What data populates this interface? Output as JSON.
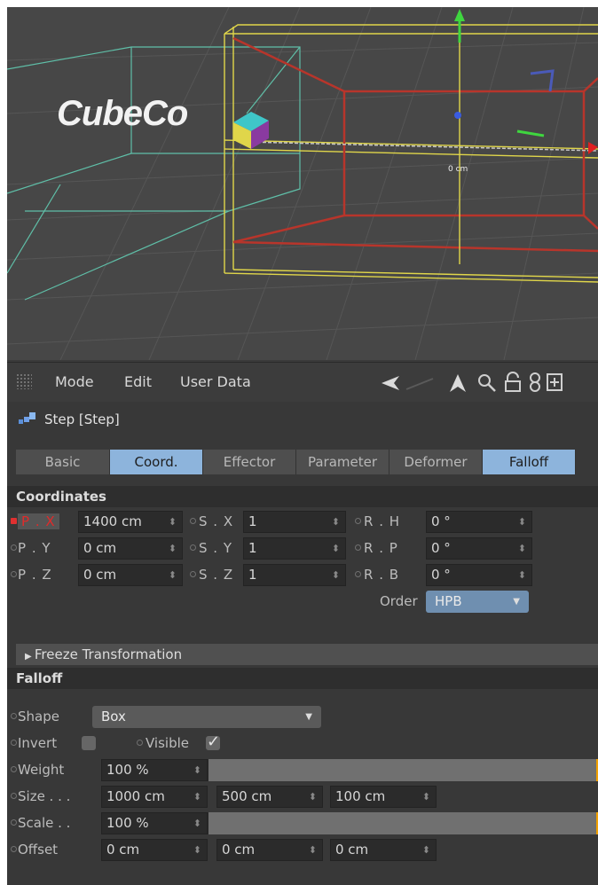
{
  "viewport": {
    "object_text": "CubeCo",
    "axis_readout": "0 cm"
  },
  "menubar": {
    "grip_icon": "grip-icon",
    "mode": "Mode",
    "edit": "Edit",
    "user_data": "User Data",
    "icons": [
      "back-arrow-icon",
      "up-arrow-icon",
      "search-icon",
      "lock-icon",
      "link-icon",
      "new-window-icon"
    ]
  },
  "object": {
    "name": "Step [Step]",
    "icon": "step-effector-icon"
  },
  "tabs": [
    {
      "label": "Basic",
      "active": false
    },
    {
      "label": "Coord.",
      "active": true
    },
    {
      "label": "Effector",
      "active": false
    },
    {
      "label": "Parameter",
      "active": false
    },
    {
      "label": "Deformer",
      "active": false
    },
    {
      "label": "Falloff",
      "active": true
    }
  ],
  "coordinates": {
    "title": "Coordinates",
    "px_label": "P . X",
    "px_value": "1400 cm",
    "py_label": "P . Y",
    "py_value": "0 cm",
    "pz_label": "P . Z",
    "pz_value": "0 cm",
    "sx_label": "S . X",
    "sx_value": "1",
    "sy_label": "S . Y",
    "sy_value": "1",
    "sz_label": "S . Z",
    "sz_value": "1",
    "rh_label": "R . H",
    "rh_value": "0 °",
    "rp_label": "R . P",
    "rp_value": "0 °",
    "rb_label": "R . B",
    "rb_value": "0 °",
    "order_label": "Order",
    "order_value": "HPB",
    "freeze": "Freeze Transformation"
  },
  "falloff": {
    "title": "Falloff",
    "shape_label": "Shape",
    "shape_value": "Box",
    "invert_label": "Invert",
    "visible_label": "Visible",
    "visible_checked": true,
    "weight_label": "Weight",
    "weight_value": "100 %",
    "weight_level": 1.0,
    "size_label": "Size . . .",
    "size_values": [
      "1000 cm",
      "500 cm",
      "100 cm"
    ],
    "scale_label": "Scale . .",
    "scale_value": "100 %",
    "scale_level": 1.0,
    "offset_label": "Offset",
    "offset_values": [
      "0 cm",
      "0 cm",
      "0 cm"
    ]
  },
  "colors": {
    "active_tab": "#8db4dc",
    "dropdown": "#6f8fb0",
    "slider_end": "#f0a000",
    "key_dot": "#e03030"
  }
}
